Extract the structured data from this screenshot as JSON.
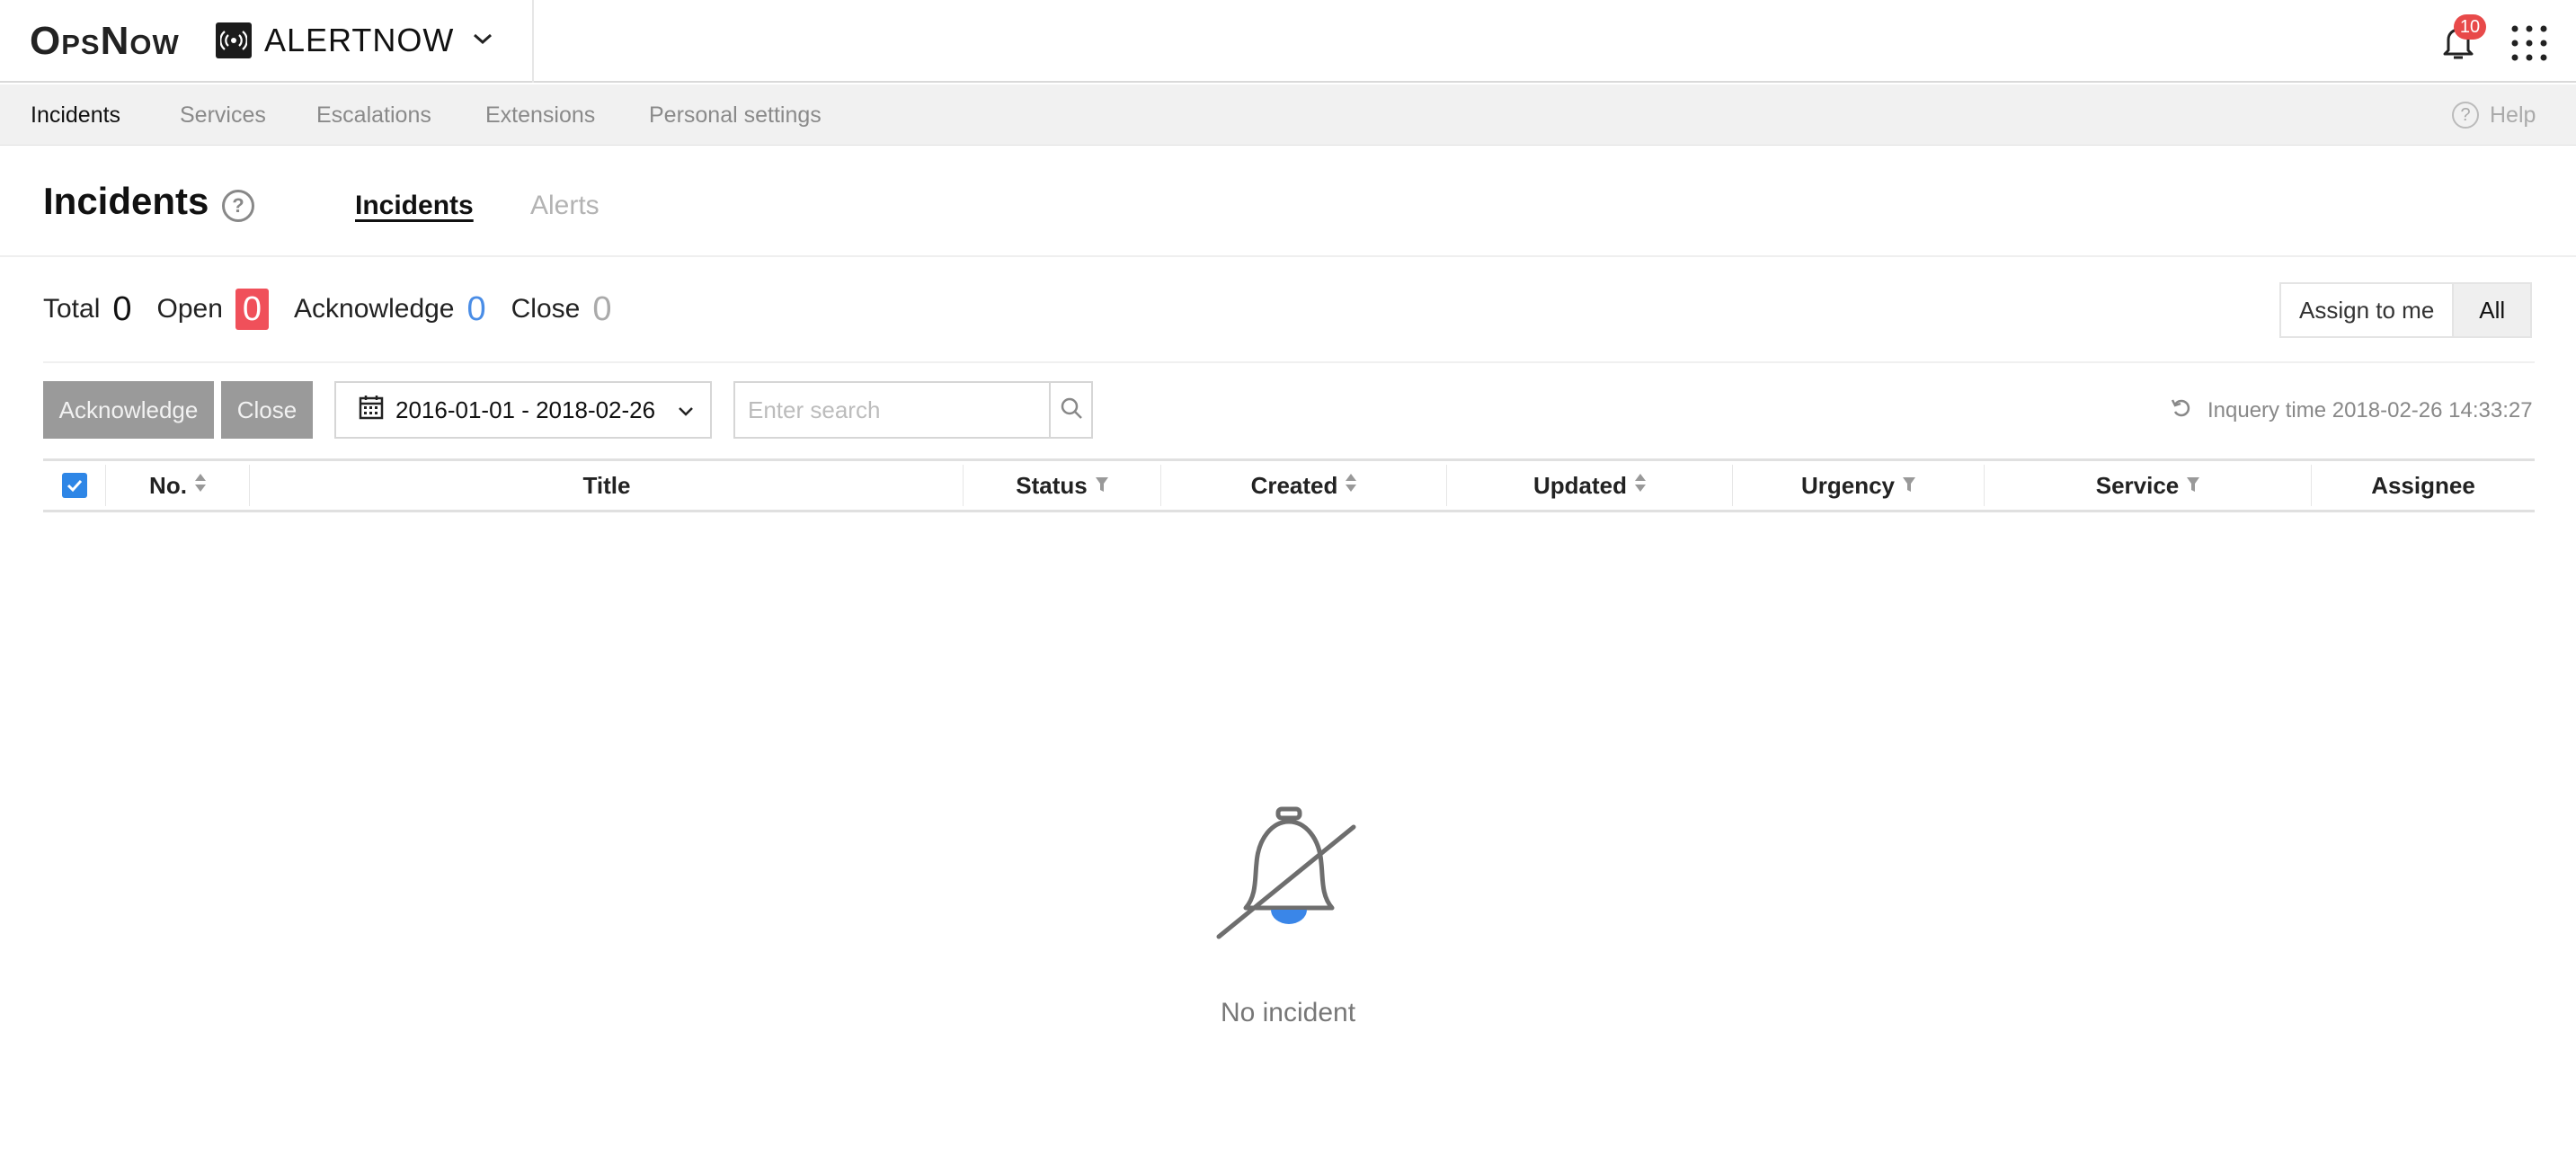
{
  "topbar": {
    "brand": "OpsNow",
    "product": "ALERTNOW",
    "notifications_count": "10"
  },
  "nav": {
    "items": [
      {
        "label": "Incidents"
      },
      {
        "label": "Services"
      },
      {
        "label": "Escalations"
      },
      {
        "label": "Extensions"
      },
      {
        "label": "Personal settings"
      }
    ],
    "help": "Help"
  },
  "page": {
    "title": "Incidents",
    "tabs": [
      {
        "label": "Incidents",
        "active": true
      },
      {
        "label": "Alerts",
        "active": false
      }
    ]
  },
  "counts": {
    "total_label": "Total",
    "total": "0",
    "open_label": "Open",
    "open": "0",
    "ack_label": "Acknowledge",
    "ack": "0",
    "close_label": "Close",
    "close": "0"
  },
  "filter": {
    "assign_to_me": "Assign to me",
    "all": "All"
  },
  "toolbar": {
    "acknowledge": "Acknowledge",
    "close": "Close",
    "date_range": "2016-01-01 - 2018-02-26",
    "search_placeholder": "Enter search",
    "inquery_time": "Inquery time 2018-02-26 14:33:27"
  },
  "table": {
    "columns": [
      "No.",
      "Title",
      "Status",
      "Created",
      "Updated",
      "Urgency",
      "Service",
      "Assignee"
    ],
    "rows": []
  },
  "empty": {
    "message": "No incident"
  },
  "colors": {
    "accent_blue": "#2e86e6",
    "open_red": "#f0505a",
    "ack_blue": "#4a8de6",
    "badge_red": "#e84a4a"
  }
}
